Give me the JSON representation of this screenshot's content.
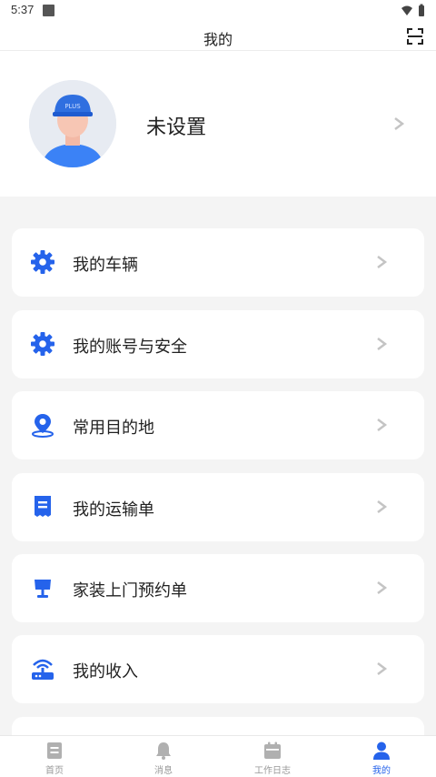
{
  "status": {
    "time": "5:37"
  },
  "header": {
    "title": "我的"
  },
  "profile": {
    "name": "未设置"
  },
  "menu": [
    {
      "label": "我的车辆",
      "icon": "gear-icon"
    },
    {
      "label": "我的账号与安全",
      "icon": "gear-icon"
    },
    {
      "label": "常用目的地",
      "icon": "location-pin-icon"
    },
    {
      "label": "我的运输单",
      "icon": "document-icon"
    },
    {
      "label": "家装上门预约单",
      "icon": "lamp-icon"
    },
    {
      "label": "我的收入",
      "icon": "router-icon"
    }
  ],
  "tabs": [
    {
      "label": "首页",
      "icon": "home-doc-icon"
    },
    {
      "label": "消息",
      "icon": "bell-icon"
    },
    {
      "label": "工作日志",
      "icon": "calendar-icon"
    },
    {
      "label": "我的",
      "icon": "person-icon"
    }
  ],
  "colors": {
    "accent": "#2563eb",
    "inactive": "#b0b0b0",
    "chevron": "#c4c4c4"
  }
}
